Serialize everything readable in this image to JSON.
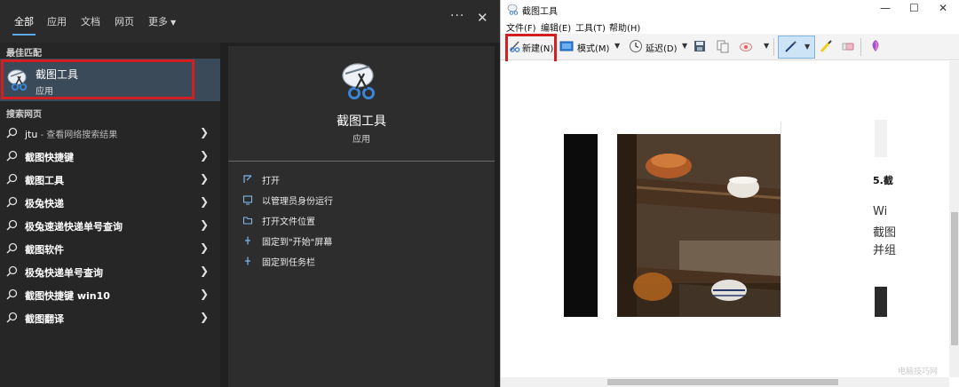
{
  "search": {
    "tabs": {
      "all": "全部",
      "apps": "应用",
      "docs": "文档",
      "web": "网页",
      "more": "更多"
    },
    "more_options": "···",
    "close": "✕",
    "best_match_label": "最佳匹配",
    "best_match": {
      "title": "截图工具",
      "subtitle": "应用"
    },
    "web_label": "搜索网页",
    "web_first": {
      "keyword": "jtu",
      "hint": " - 查看网络搜索结果"
    },
    "web_results": [
      "截图快捷键",
      "截图工具",
      "极兔快递",
      "极兔速递快递单号查询",
      "截图软件",
      "极兔快递单号查询",
      "截图快捷键 win10",
      "截图翻译"
    ],
    "preview": {
      "title": "截图工具",
      "subtitle": "应用",
      "actions": [
        "打开",
        "以管理员身份运行",
        "打开文件位置",
        "固定到\"开始\"屏幕",
        "固定到任务栏"
      ]
    }
  },
  "snip": {
    "title": "截图工具",
    "window_controls": {
      "minimize": "—",
      "maximize": "☐",
      "close": "✕"
    },
    "menu": [
      "文件(F)",
      "编辑(E)",
      "工具(T)",
      "帮助(H)"
    ],
    "toolbar": {
      "new": "新建(N)",
      "mode": "模式(M)",
      "delay": "延迟(D)"
    },
    "content": {
      "heading": "5.截",
      "lines": [
        "Wi",
        "截图",
        "并组"
      ]
    },
    "watermark": "电脑技巧网"
  },
  "colors": {
    "accent": "#5aa9ee",
    "highlight_red": "#d11f22",
    "selection": "#3b4a59"
  }
}
